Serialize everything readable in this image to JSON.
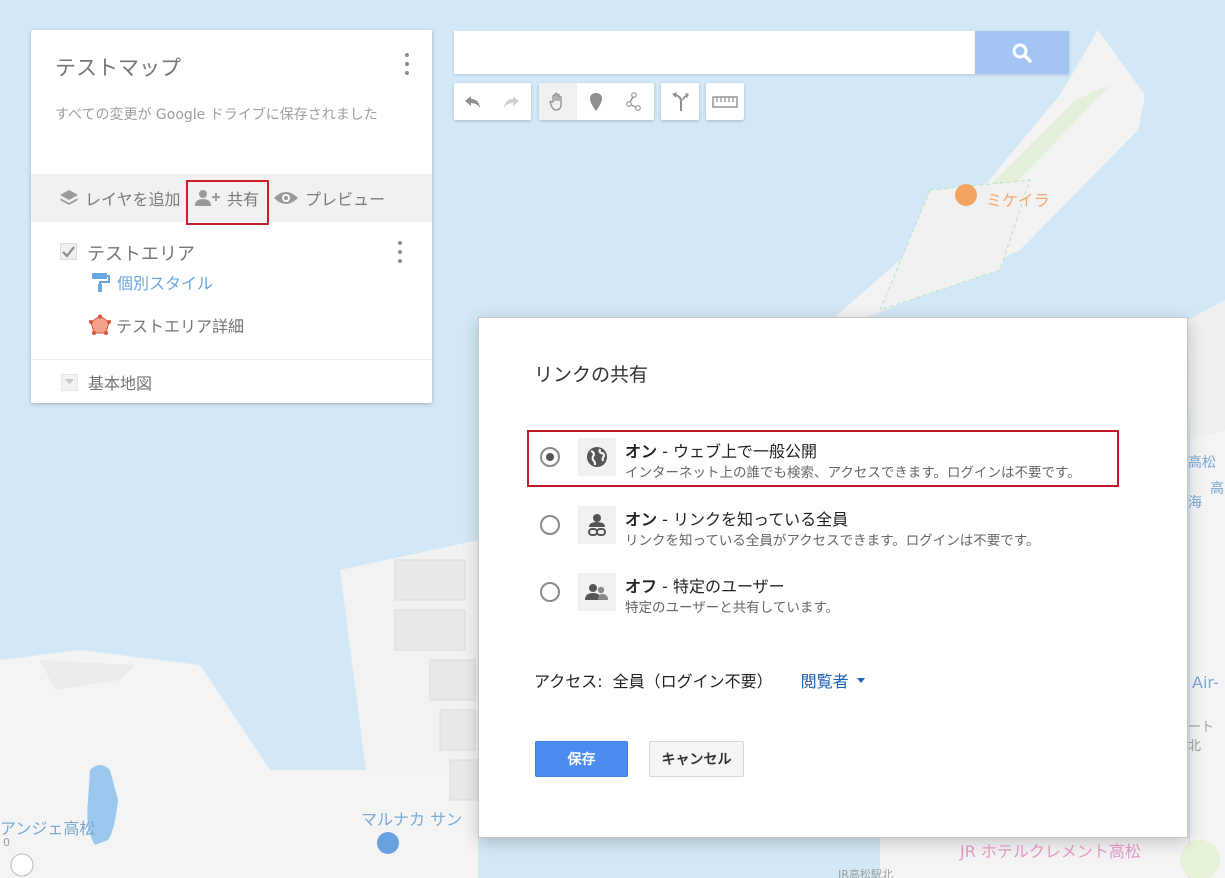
{
  "map": {
    "labels": {
      "poi": "ミケイラ",
      "angie": "アンジェ高松",
      "marunaka": "マルナカ サン",
      "jr_hotel": "JR ホテルクレメント高松",
      "air": "Air-",
      "right1": "高松",
      "right2": "海",
      "right3": "高",
      "ken": "ート",
      "north": "北",
      "station": "JR高松駅北",
      "zero": "0"
    }
  },
  "panel": {
    "title": "テストマップ",
    "subtitle": "すべての変更が Google ドライブに保存されました",
    "toolbar": {
      "add_layer": "レイヤを追加",
      "share": "共有",
      "preview": "プレビュー"
    },
    "layer": {
      "name": "テストエリア",
      "style_link": "個別スタイル",
      "feature": "テストエリア詳細"
    },
    "basemap": "基本地図"
  },
  "search": {
    "placeholder": ""
  },
  "dialog": {
    "title": "リンクの共有",
    "options": [
      {
        "state": "オン",
        "label": " - ウェブ上で一般公開",
        "desc": "インターネット上の誰でも検索、アクセスできます。ログインは不要です。",
        "icon": "globe-icon",
        "checked": true
      },
      {
        "state": "オン",
        "label": " - リンクを知っている全員",
        "desc": "リンクを知っている全員がアクセスできます。ログインは不要です。",
        "icon": "link-person-icon",
        "checked": false
      },
      {
        "state": "オフ",
        "label": " - 特定のユーザー",
        "desc": "特定のユーザーと共有しています。",
        "icon": "people-icon",
        "checked": false
      }
    ],
    "access_label": "アクセス:",
    "access_value": "全員（ログイン不要）",
    "access_role": "閲覧者",
    "save": "保存",
    "cancel": "キャンセル"
  },
  "colors": {
    "water": "#d3e8f7",
    "highlight_border": "#cc1f2a",
    "save_button": "#4a8cf0",
    "link_blue": "#1a62b5"
  }
}
